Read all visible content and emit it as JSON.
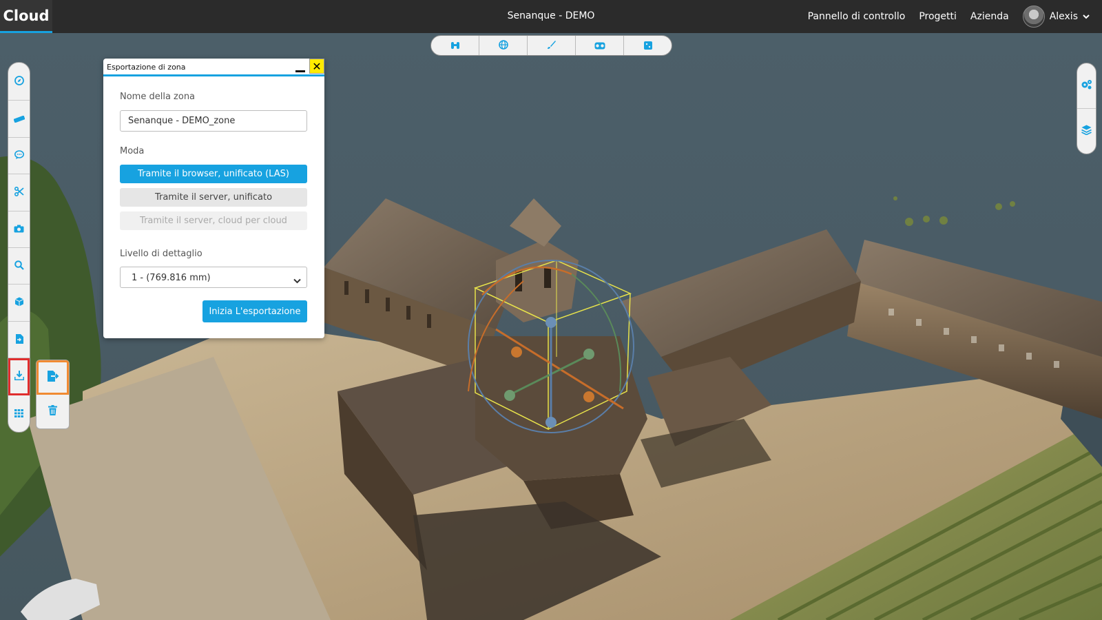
{
  "app": {
    "brand": "Cloud",
    "project_title": "Senanque - DEMO"
  },
  "nav": {
    "links": [
      "Pannello di controllo",
      "Progetti",
      "Azienda"
    ],
    "user_name": "Alexis"
  },
  "top_tools": [
    {
      "icon": "binoculars-icon"
    },
    {
      "icon": "globe-icon"
    },
    {
      "icon": "paintbrush-icon"
    },
    {
      "icon": "vr-headset-icon"
    },
    {
      "icon": "cube-face-icon"
    }
  ],
  "left_tools": [
    {
      "icon": "compass-icon"
    },
    {
      "icon": "ruler-icon"
    },
    {
      "icon": "comment-icon"
    },
    {
      "icon": "scissors-icon"
    },
    {
      "icon": "camera-icon"
    },
    {
      "icon": "search-icon"
    },
    {
      "icon": "cube-icon"
    },
    {
      "icon": "file-import-icon"
    },
    {
      "icon": "download-icon",
      "active": true
    },
    {
      "icon": "grid-icon"
    }
  ],
  "sub_tools": [
    {
      "icon": "file-export-icon",
      "highlighted": true
    },
    {
      "icon": "trash-icon"
    }
  ],
  "right_tools": [
    {
      "icon": "settings-cogs-icon"
    },
    {
      "icon": "layers-icon"
    }
  ],
  "dialog": {
    "title": "Esportazione di zona",
    "zone_name_label": "Nome della zona",
    "zone_name_value": "Senanque - DEMO_zone",
    "mode_label": "Moda",
    "modes": [
      {
        "label": "Tramite il browser, unificato (LAS)",
        "state": "active"
      },
      {
        "label": "Tramite il server, unificato",
        "state": "normal"
      },
      {
        "label": "Tramite il server, cloud per cloud",
        "state": "disabled"
      }
    ],
    "detail_label": "Livello di dettaglio",
    "detail_value": "1 - (769.816 mm)",
    "start_button": "Inizia L'esportazione"
  },
  "colors": {
    "accent": "#17a2e0",
    "navbar": "#2b2b2b",
    "close_button": "#ffeb00",
    "active_tool_outline": "#e02d2d",
    "subtool_outline": "#f08a32"
  }
}
